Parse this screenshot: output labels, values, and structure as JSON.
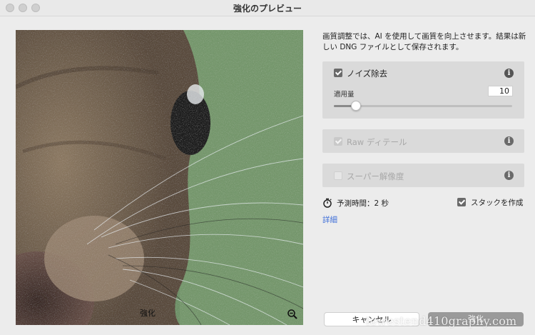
{
  "window": {
    "title": "強化のプレビュー"
  },
  "preview": {
    "label": "強化",
    "zoom_icon": "zoom-out-icon"
  },
  "description": "画質調整では、AI を使用して画質を向上させます。結果は新しい DNG ファイルとして保存されます。",
  "options": {
    "noise_reduction": {
      "label": "ノイズ除去",
      "checked": true,
      "enabled": true,
      "amount_label": "適用量",
      "amount_value": "10",
      "amount_fraction": 0.1
    },
    "raw_details": {
      "label": "Raw ディテール",
      "checked": true,
      "enabled": false
    },
    "super_resolution": {
      "label": "スーパー解像度",
      "checked": false,
      "enabled": false
    }
  },
  "estimate": {
    "text": "予測時間：2 秒",
    "icon": "timer-icon"
  },
  "stack": {
    "label": "スタックを作成",
    "checked": true
  },
  "details_link": "詳細",
  "buttons": {
    "cancel": "キャンセル",
    "enhance": "強化"
  },
  "watermark": "tewestend410graphy.com",
  "colors": {
    "link": "#3f6fd8",
    "panel": "#dadada",
    "background": "#ececec"
  }
}
